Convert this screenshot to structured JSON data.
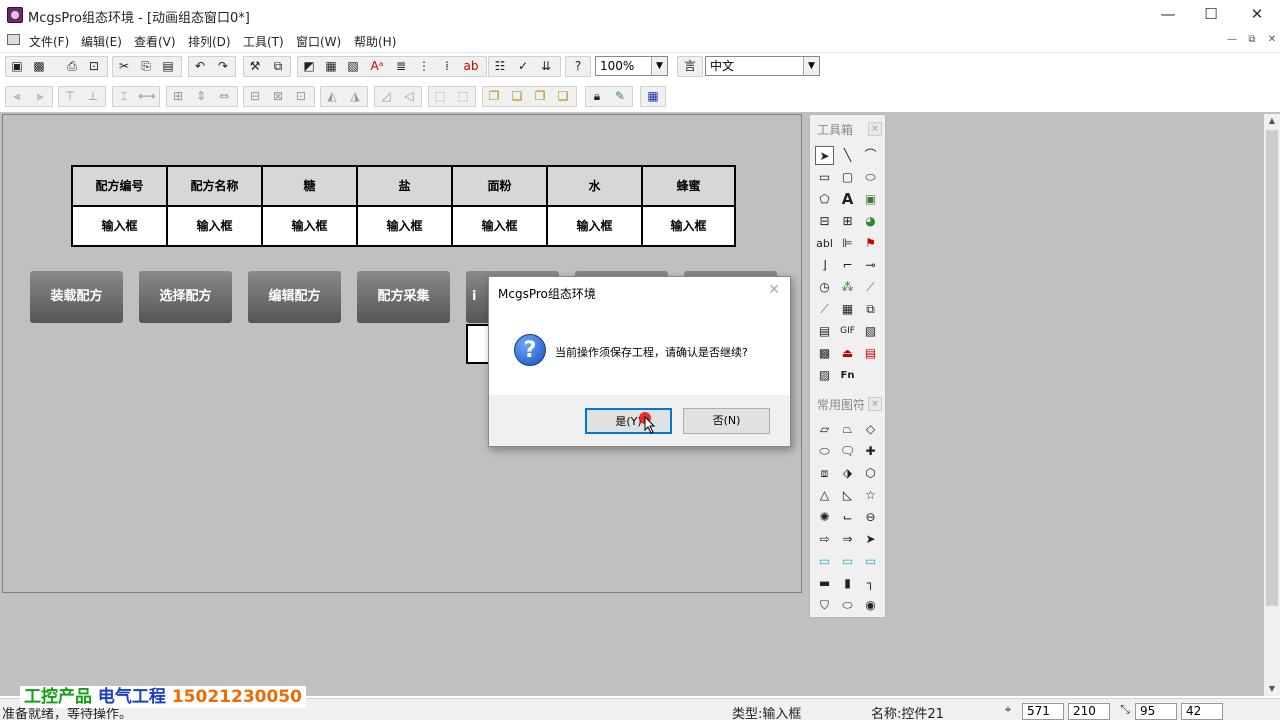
{
  "window": {
    "title": "McgsPro组态环境 - [动画组态窗口0*]",
    "min": "—",
    "max": "☐",
    "close": "✕"
  },
  "menu": [
    "文件(F)",
    "编辑(E)",
    "查看(V)",
    "排列(D)",
    "工具(T)",
    "窗口(W)",
    "帮助(H)"
  ],
  "mdi_controls": [
    "—",
    "⧉",
    "✕"
  ],
  "toolbar": {
    "zoom_value": "100%",
    "language_value": "中文"
  },
  "grid": {
    "headers": [
      "配方编号",
      "配方名称",
      "糖",
      "盐",
      "面粉",
      "水",
      "蜂蜜"
    ],
    "cells": [
      "输入框",
      "输入框",
      "输入框",
      "输入框",
      "输入框",
      "输入框",
      "输入框"
    ]
  },
  "recipe_buttons": [
    "装载配方",
    "选择配方",
    "编辑配方",
    "配方采集"
  ],
  "hidden_button_fragment": "i",
  "palette": {
    "toolbox_title": "工具箱",
    "symbols_title": "常用图符",
    "close": "×"
  },
  "dialog": {
    "title": "McgsPro组态环境",
    "message": "当前操作须保存工程，请确认是否继续?",
    "yes_label": "是(Y)",
    "no_label": "否(N)",
    "icon": "question-icon",
    "close": "✕"
  },
  "status": {
    "left_text": "准备就绪，等待操作。",
    "type_text": "类型:输入框",
    "name_text": "名称:控件21",
    "x": "571",
    "y": "210",
    "w": "95",
    "h": "42"
  },
  "watermark": {
    "part1": "工控产品",
    "part2": "电气工程",
    "part3": "15021230050"
  },
  "colors": {
    "canvas": "#c0c0c0",
    "accent": "#0078d7",
    "button_top": "#8a8a8a",
    "button_bottom": "#555555"
  }
}
